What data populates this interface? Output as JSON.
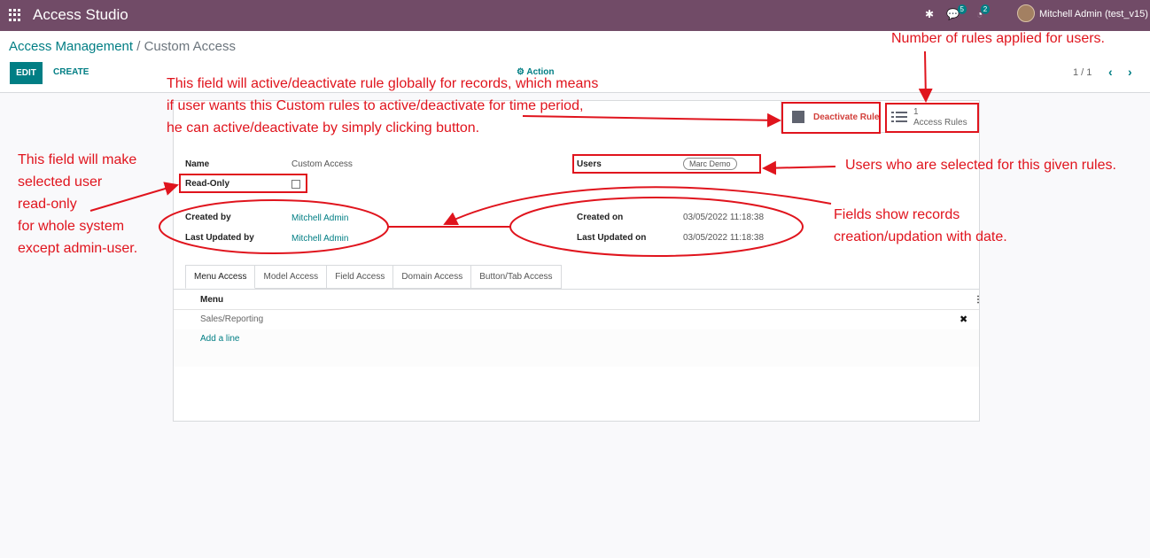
{
  "topbar": {
    "app_title": "Access Studio",
    "messages_count": "5",
    "activities_count": "2",
    "user_name": "Mitchell Admin (test_v15)"
  },
  "breadcrumb": {
    "parent": "Access Management",
    "separator": "/",
    "current": "Custom Access"
  },
  "control": {
    "edit_label": "EDIT",
    "create_label": "CREATE",
    "action_label": "Action",
    "pager": "1 / 1"
  },
  "buttonbox": {
    "deactivate_label": "Deactivate Rule",
    "rules_count": "1",
    "rules_label": "Access Rules"
  },
  "form": {
    "name_label": "Name",
    "name_value": "Custom Access",
    "readonly_label": "Read-Only",
    "users_label": "Users",
    "users_tag": "Marc Demo",
    "created_by_label": "Created by",
    "created_by_value": "Mitchell Admin",
    "updated_by_label": "Last Updated by",
    "updated_by_value": "Mitchell Admin",
    "created_on_label": "Created on",
    "created_on_value": "03/05/2022 11:18:38",
    "updated_on_label": "Last Updated on",
    "updated_on_value": "03/05/2022 11:18:38"
  },
  "tabs": [
    "Menu Access",
    "Model Access",
    "Field Access",
    "Domain Access",
    "Button/Tab Access"
  ],
  "list": {
    "column": "Menu",
    "rows": [
      "Sales/Reporting"
    ],
    "add_line": "Add a line"
  },
  "annotations": {
    "rules_count_note": "Number of rules applied for users.",
    "active_line1": "This field will active/deactivate rule globally for records, which means",
    "active_line2": "if user wants this Custom rules to active/deactivate for time period,",
    "active_line3": "he can active/deactivate by simply clicking button.",
    "readonly_line1": "This field will make",
    "readonly_line2": "selected user",
    "readonly_line3": "read-only",
    "readonly_line4": "for whole system",
    "readonly_line5": "except admin-user.",
    "users_note": "Users who are selected for this given rules.",
    "fields_line1": "Fields show records",
    "fields_line2": "creation/updation with date."
  },
  "colors": {
    "brand": "#714b67",
    "accent": "#017e84",
    "annotation": "#e0141d"
  }
}
